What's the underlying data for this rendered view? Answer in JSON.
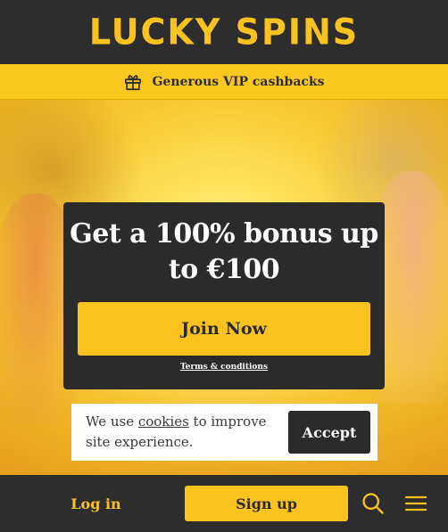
{
  "header": {
    "logo_text": "LUCKY SPINS"
  },
  "promo": {
    "icon": "gift-icon",
    "text": "Generous VIP cashbacks"
  },
  "bonus": {
    "title_line1": "Get a 100% bonus up",
    "title_line2": "to €100",
    "join_label": "Join Now",
    "terms_label": "Terms & conditions"
  },
  "cookie": {
    "text_before": "We use ",
    "link_text": "cookies",
    "text_after": " to improve site experience.",
    "accept_label": "Accept"
  },
  "bottom_nav": {
    "login_label": "Log in",
    "signup_label": "Sign up",
    "search_icon": "search-icon",
    "menu_icon": "hamburger-menu-icon"
  },
  "colors": {
    "brand_yellow": "#fcc31e",
    "dark": "#2d2d2d",
    "white": "#ffffff"
  }
}
